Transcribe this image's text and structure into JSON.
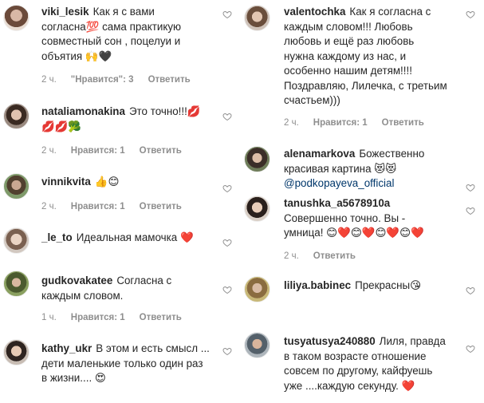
{
  "left": [
    {
      "user": "viki_lesik",
      "lines": [
        "Как я с вами",
        "согласна💯 сама практикую",
        "совместный сон , поцелуи и",
        "объятия 🙌🖤"
      ],
      "time": "2 ч.",
      "likes": "\"Нравится\": 3",
      "reply": "Ответить"
    },
    {
      "user": "nataliamonakina",
      "lines": [
        "Это точно!!!💋",
        "💋💋🥦"
      ],
      "time": "2 ч.",
      "likes": "Нравится: 1",
      "reply": "Ответить"
    },
    {
      "user": "vinnikvita",
      "lines": [
        "👍😊"
      ],
      "time": "2 ч.",
      "likes": "Нравится: 1",
      "reply": "Ответить"
    },
    {
      "user": "_le_to",
      "lines": [
        "Идеальная мамочка ❤️"
      ],
      "time": "",
      "likes": "",
      "reply": ""
    },
    {
      "user": "gudkovakatee",
      "lines": [
        "Согласна с",
        "каждым словом."
      ],
      "time": "1 ч.",
      "likes": "Нравится: 1",
      "reply": "Ответить"
    },
    {
      "user": "kathy_ukr",
      "lines": [
        "В этом и есть смысл ...",
        "дети маленькие только один раз",
        "в жизни.... 😍"
      ],
      "time": "",
      "likes": "",
      "reply": ""
    }
  ],
  "right": [
    {
      "user": "valentochka",
      "lines": [
        "Как я согласна с",
        "каждым словом!!! Любовь",
        "любовь и ещё раз любовь",
        "нужна каждому из нас, и",
        "особенно нашим детям!!!!",
        "Поздравляю, Лилечка, с третьим",
        "счастьем)))"
      ],
      "time": "2 ч.",
      "likes": "Нравится: 1",
      "reply": "Ответить"
    },
    {
      "user": "alenamarkova",
      "lines": [
        "Божественно",
        "красивая картина 😻😻",
        "@podkopayeva_official"
      ],
      "time": "",
      "likes": "",
      "reply": ""
    },
    {
      "user": "tanushka_a5678910a",
      "lines": [
        "",
        "Совершенно точно. Вы -",
        "умница! 😊❤️😊❤️😊❤️😊❤️"
      ],
      "time": "2 ч.",
      "likes": "",
      "reply": "Ответить"
    },
    {
      "user": "liliya.babinec",
      "lines": [
        "Прекрасны😘"
      ],
      "time": "",
      "likes": "",
      "reply": ""
    },
    {
      "user": "tusyatusya240880",
      "lines": [
        "Лиля, правда",
        "в таком возрасте отношение",
        "совсем по другому, кайфуешь",
        "уже ....каждую секунду. ❤️"
      ],
      "time": "",
      "likes": "",
      "reply": ""
    }
  ],
  "icons": {
    "like": "heart-outline-icon"
  },
  "colors": {
    "text": "#262626",
    "meta": "#8e8e8e",
    "link": "#00376b",
    "bg": "#ffffff"
  }
}
